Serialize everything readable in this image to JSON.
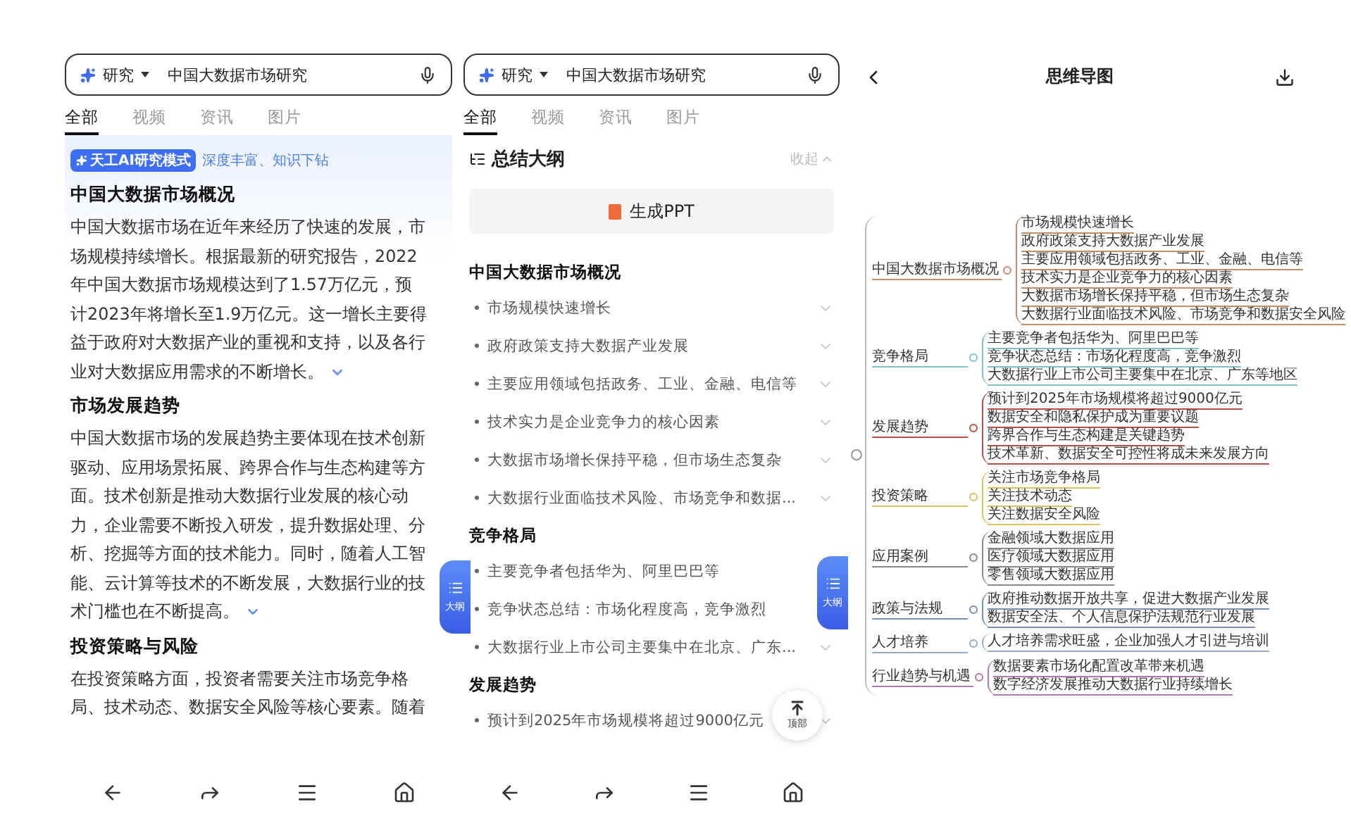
{
  "search_panel": {
    "search": {
      "mode": "研究",
      "query": "中国大数据市场研究"
    },
    "tabs": [
      {
        "label": "全部",
        "selected": true
      },
      {
        "label": "视频",
        "selected": false
      },
      {
        "label": "资讯",
        "selected": false
      },
      {
        "label": "图片",
        "selected": false
      }
    ],
    "badge": "天工AI研究模式",
    "badge_note": "深度丰富、知识下钻",
    "sections": [
      {
        "title": "中国大数据市场概况",
        "body": "中国大数据市场在近年来经历了快速的发展，市场规模持续增长。根据最新的研究报告，2022年中国大数据市场规模达到了1.57万亿元，预计2023年将增长至1.9万亿元。这一增长主要得益于政府对大数据产业的重视和支持，以及各行业对大数据应用需求的不断增长。",
        "expandable": true
      },
      {
        "title": "市场发展趋势",
        "body": "中国大数据市场的发展趋势主要体现在技术创新驱动、应用场景拓展、跨界合作与生态构建等方面。技术创新是推动大数据行业发展的核心动力，企业需要不断投入研发，提升数据处理、分析、挖掘等方面的技术能力。同时，随着人工智能、云计算等技术的不断发展，大数据行业的技术门槛也在不断提高。",
        "expandable": true
      },
      {
        "title": "投资策略与风险",
        "body": "在投资策略方面，投资者需要关注市场竞争格局、技术动态、数据安全风险等核心要素。随着",
        "expandable": false
      }
    ],
    "float_button": "大纲"
  },
  "outline_panel": {
    "search": {
      "mode": "研究",
      "query": "中国大数据市场研究"
    },
    "tabs": [
      {
        "label": "全部",
        "selected": true
      },
      {
        "label": "视频",
        "selected": false
      },
      {
        "label": "资讯",
        "selected": false
      },
      {
        "label": "图片",
        "selected": false
      }
    ],
    "outline_title": "总结大纲",
    "collapse": "收起",
    "ppt_button": "生成PPT",
    "groups": [
      {
        "title": "中国大数据市场概况",
        "items": [
          "市场规模快速增长",
          "政府政策支持大数据产业发展",
          "主要应用领域包括政务、工业、金融、电信等",
          "技术实力是企业竞争力的核心因素",
          "大数据市场增长保持平稳，但市场生态复杂",
          "大数据行业面临技术风险、市场竞争和数据..."
        ]
      },
      {
        "title": "竞争格局",
        "items": [
          "主要竞争者包括华为、阿里巴巴等",
          "竞争状态总结：市场化程度高，竞争激烈",
          "大数据行业上市公司主要集中在北京、广东..."
        ]
      },
      {
        "title": "发展趋势",
        "items": [
          "预计到2025年市场规模将超过9000亿元"
        ]
      }
    ],
    "float_button": "大纲",
    "top_button": "顶部"
  },
  "mindmap_panel": {
    "title": "思维导图",
    "branches": [
      {
        "label": "中国大数据市场概况",
        "color": "#c98a6a",
        "leaves": [
          "市场规模快速增长",
          "政府政策支持大数据产业发展",
          "主要应用领域包括政务、工业、金融、电信等",
          "技术实力是企业竞争力的核心因素",
          "大数据市场增长保持平稳，但市场生态复杂",
          "大数据行业面临技术风险、市场竞争和数据安全风险"
        ]
      },
      {
        "label": "竞争格局",
        "color": "#7fc4c4",
        "leaves": [
          "主要竞争者包括华为、阿里巴巴等",
          "竞争状态总结：市场化程度高，竞争激烈",
          "大数据行业上市公司主要集中在北京、广东等地区"
        ]
      },
      {
        "label": "发展趋势",
        "color": "#b5504a",
        "leaves": [
          "预计到2025年市场规模将超过9000亿元",
          "数据安全和隐私保护成为重要议题",
          "跨界合作与生态构建是关键趋势",
          "技术革新、数据安全可控性将成未来发展方向"
        ]
      },
      {
        "label": "投资策略",
        "color": "#d9c25a",
        "leaves": [
          "关注市场竞争格局",
          "关注技术动态",
          "关注数据安全风险"
        ]
      },
      {
        "label": "应用案例",
        "color": "#8a8a8a",
        "leaves": [
          "金融领域大数据应用",
          "医疗领域大数据应用",
          "零售领域大数据应用"
        ]
      },
      {
        "label": "政策与法规",
        "color": "#7a8fb0",
        "leaves": [
          "政府推动数据开放共享，促进大数据产业发展",
          "数据安全法、个人信息保护法规范行业发展"
        ]
      },
      {
        "label": "人才培养",
        "color": "#9aa6c8",
        "leaves": [
          "人才培养需求旺盛，企业加强人才引进与培训"
        ]
      },
      {
        "label": "行业趋势与机遇",
        "color": "#b07aa8",
        "leaves": [
          "数据要素市场化配置改革带来机遇",
          "数字经济发展推动大数据行业持续增长"
        ]
      }
    ]
  }
}
